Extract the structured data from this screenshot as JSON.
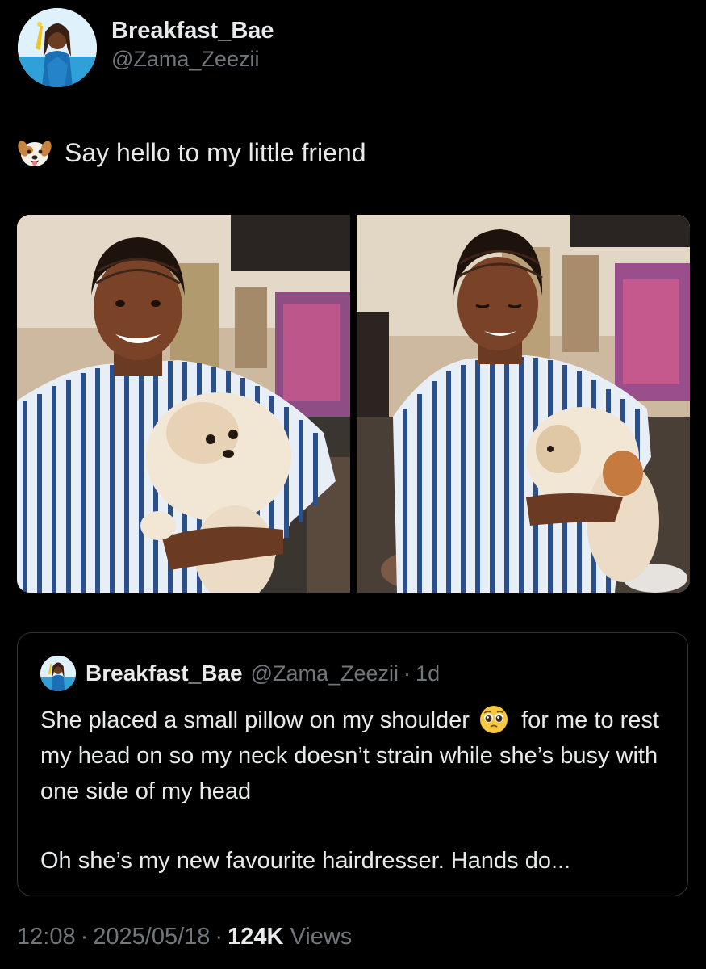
{
  "tweet": {
    "author": {
      "display_name": "Breakfast_Bae",
      "handle": "@Zama_Zeezii",
      "avatar_icon": "profile-avatar"
    },
    "text": "Say hello to my little friend",
    "leading_emoji": "dog-face-emoji",
    "media": [
      {
        "type": "photo",
        "icon": "photo"
      },
      {
        "type": "photo",
        "icon": "photo"
      }
    ],
    "quote": {
      "display_name": "Breakfast_Bae",
      "handle": "@Zama_Zeezii",
      "separator": "·",
      "time": "1d",
      "text_part1": "She placed a small pillow on my shoulder",
      "emoji": "pleading-face-emoji",
      "text_part2": "for me to rest my head on so my neck doesn’t strain while she’s busy with one side of my head",
      "text_second_paragraph": "Oh she’s my new favourite hairdresser. Hands do..."
    },
    "meta": {
      "time": "12:08",
      "separator": "·",
      "date": "2025/05/18",
      "views_count": "124K",
      "views_label": "Views"
    }
  },
  "colors": {
    "background": "#000000",
    "text_primary": "#e7e9ea",
    "text_secondary": "#71767b",
    "border": "#2f3336"
  }
}
